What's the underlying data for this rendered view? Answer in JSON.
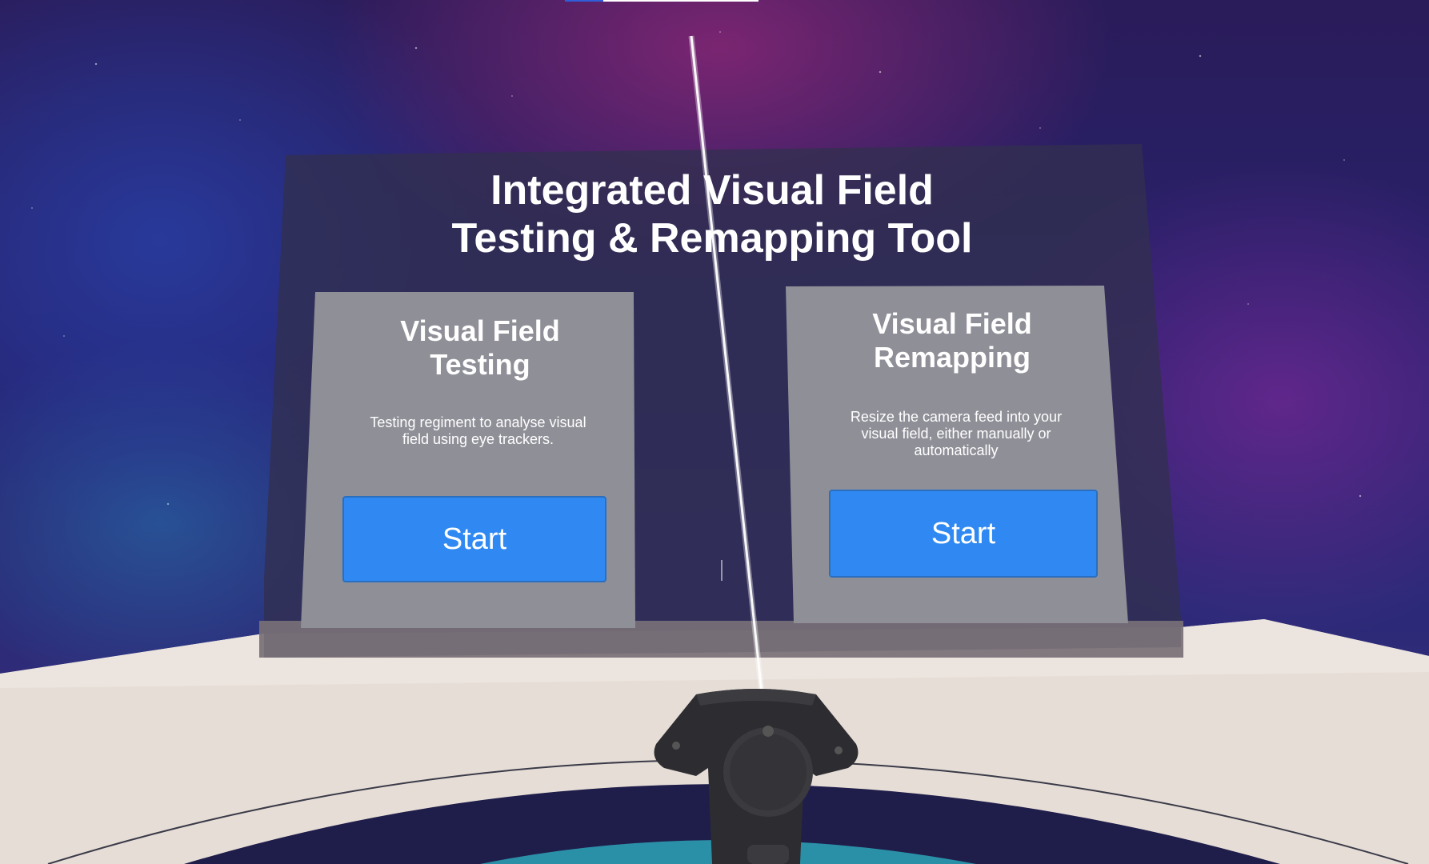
{
  "app": {
    "title": "Integrated Visual Field Testing & Remapping Tool"
  },
  "cards": [
    {
      "title_line1": "Visual Field",
      "title_line2": "Testing",
      "description_line1": "Testing regiment to analyse visual",
      "description_line2": "field using eye trackers.",
      "button_label": "Start"
    },
    {
      "title_line1": "Visual Field",
      "title_line2": "Remapping",
      "description_line1": "Resize the camera feed into your",
      "description_line2": "visual field, either manually or",
      "description_line3": "automatically",
      "button_label": "Start"
    }
  ],
  "colors": {
    "button": "#3089f2",
    "card": "#8f8f98",
    "panel": "#32304f",
    "desk": "#e6ddd6",
    "floor_ring_teal": "#2a90a8"
  },
  "icons": {
    "controller": "vr-controller-icon",
    "laser": "laser-pointer"
  }
}
